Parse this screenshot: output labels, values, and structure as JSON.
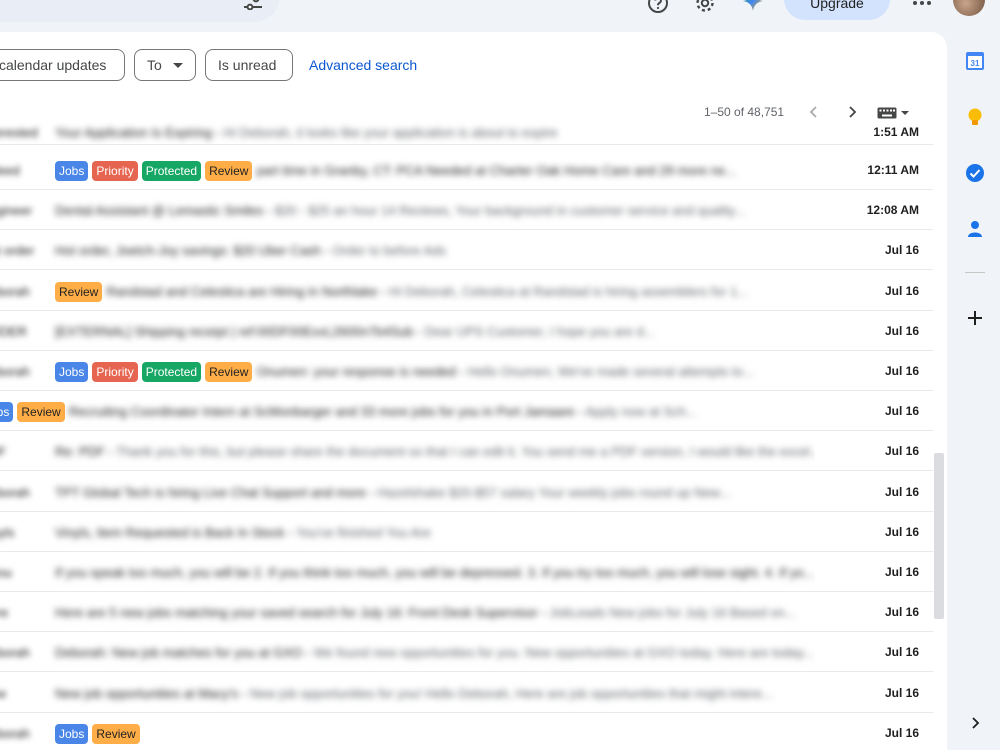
{
  "header": {
    "upgrade_label": "Upgrade"
  },
  "filters": {
    "chip_calendar": "calendar updates",
    "chip_to": "To",
    "chip_unread": "Is unread",
    "advanced_search": "Advanced search"
  },
  "pager": {
    "range": "1–50 of 48,751"
  },
  "labels": {
    "jobs": "Jobs",
    "priority": "Priority",
    "protected": "Protected",
    "review": "Review"
  },
  "rows": [
    {
      "sender": "Interested",
      "subject": "Your Application Is Expiring",
      "snippet": "Hi Deborah, it looks like your application is about to expire",
      "time": "1:51 AM",
      "tags": []
    },
    {
      "sender": "Indeed",
      "subject": "part time in Granby, CT: PCA Needed at Charter Oak Home Care and 29 more ne...",
      "snippet": "",
      "time": "12:11 AM",
      "tags": [
        "jobs",
        "priority",
        "protected",
        "review"
      ]
    },
    {
      "sender": "Engineer",
      "subject": "Dental Assistant @ Lemastic Smiles",
      "snippet": "$20 - $25 an hour 14 Reviews, Your background in customer service and quality...",
      "time": "12:08 AM",
      "tags": []
    },
    {
      "sender": "Hot order",
      "subject": "Hot order, Joetch-Joy savings: $20 Uber Cash",
      "snippet": "Order to before Ads",
      "time": "Jul 16",
      "tags": []
    },
    {
      "sender": "Deborah",
      "subject": "Randstad and Celestica are Hiring in Northlake",
      "snippet": "Hi Deborah, Celestica at Randstad is hiring assemblers for 1...",
      "time": "Jul 16",
      "tags": [
        "review"
      ]
    },
    {
      "sender": "ORDER",
      "subject": "[EXTERNAL] Shipping receipt | ref:00DF00ExxL2600n7b4Sub",
      "snippet": "Dear UPS Customer, I hope you are d...",
      "time": "Jul 16",
      "tags": []
    },
    {
      "sender": "Deborah",
      "subject": "Onumen: your response is needed",
      "snippet": "Hello Onumen, We've made several attempts to...",
      "time": "Jul 16",
      "tags": [
        "jobs",
        "priority",
        "protected",
        "review"
      ]
    },
    {
      "sender": "",
      "subject": "Recruiting Coordinator Intern at ScMonbarger and 33 more jobs for you in Port Jamaare",
      "snippet": "Apply now at Sch...",
      "time": "Jul 16",
      "tags": [
        "jobs",
        "review"
      ]
    },
    {
      "sender": "PDF",
      "subject": "Re: PDF",
      "snippet": "Thank you for this, but please share the document so that I can edit it. You send me a PDF version, I would like the excel...",
      "time": "Jul 16",
      "tags": []
    },
    {
      "sender": "Deborah",
      "subject": "TPT Global Tech is hiring Live Chat Support and more",
      "snippet": "Hazelshake $20-$57 salary Your weekly jobs round up New...",
      "time": "Jul 16",
      "tags": []
    },
    {
      "sender": "Vinyls",
      "subject": "Vinyls, Item Requested is Back In Stock",
      "snippet": "You've finished You Are",
      "time": "Jul 16",
      "tags": []
    },
    {
      "sender": "If you",
      "subject": "If you speak too much, you will be 2. If you think too much, you will be depressed. 3. If you try too much, you will lose sight. 4. If yo...",
      "snippet": "",
      "time": "Jul 16",
      "tags": []
    },
    {
      "sender": "Here",
      "subject": "Here are 5 new jobs matching your saved search for July 16: Front Desk Supervisor",
      "snippet": "JobLeads New jobs for July 16 Based on...",
      "time": "Jul 16",
      "tags": []
    },
    {
      "sender": "Deborah",
      "subject": "Deborah: New job matches for you at GXO",
      "snippet": "We found new opportunities for you. New opportunities at GXO today. Here are today...",
      "time": "Jul 16",
      "tags": []
    },
    {
      "sender": "New",
      "subject": "New job opportunities at Macy's",
      "snippet": "New job opportunities for you! Hello Deborah, Here are job opportunities that might intere...",
      "time": "Jul 16",
      "tags": []
    },
    {
      "sender": "Deborah",
      "subject": "",
      "snippet": "",
      "time": "Jul 16",
      "tags": [
        "jobs",
        "review"
      ]
    }
  ]
}
